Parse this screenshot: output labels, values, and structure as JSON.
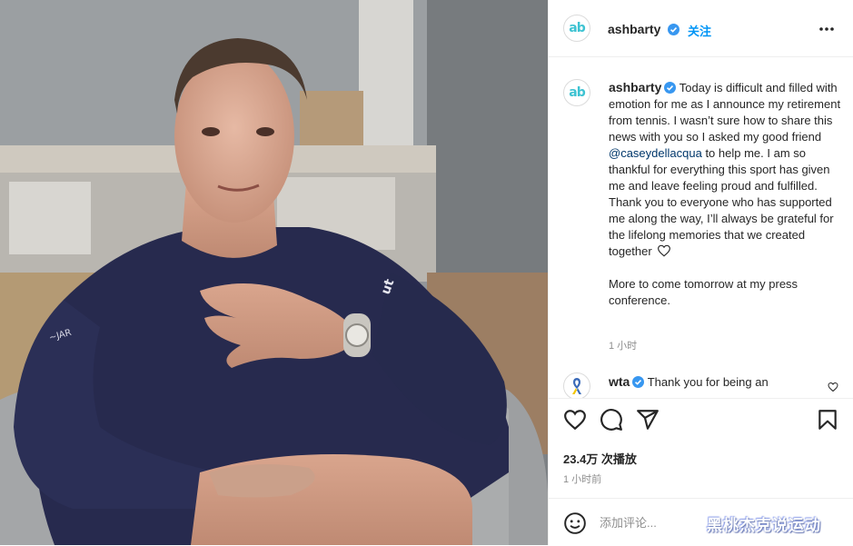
{
  "post": {
    "author": {
      "username": "ashbarty",
      "avatar_text": "ab",
      "verified": true
    },
    "follow_label": "关注",
    "caption": {
      "paragraph1_before_mention": "Today is difficult and filled with emotion for me as I announce my retirement from tennis. I wasn’t sure how to share this news with you so I asked my good friend ",
      "mention": "@caseydellacqua",
      "paragraph1_after_mention": " to help me. I am so thankful for everything this sport has given me and leave feeling proud and fulfilled. Thank you to everyone who has supported me along the way, I’ll always be grateful for the lifelong memories that we created together",
      "paragraph1_emoji": "heart-outline-icon",
      "paragraph2": "More to come tomorrow at my press conference.",
      "time": "1 小时"
    },
    "comments": [
      {
        "username": "wta",
        "verified": true,
        "text": "Thank you for being an",
        "avatar_icon": "ribbon-icon"
      }
    ],
    "actions": [
      "heart-icon",
      "comment-icon",
      "share-icon",
      "bookmark-icon"
    ],
    "views": "23.4万 次播放",
    "posted_time": "1 小时前",
    "comment_placeholder": "添加评论...",
    "watermark": "黑桃杰克说运动"
  },
  "colors": {
    "accent": "#0095f6",
    "verified": "#3897f0",
    "logo": "#3ec3d2",
    "muted": "#8e8e8e",
    "shirt": "#272a4e"
  }
}
